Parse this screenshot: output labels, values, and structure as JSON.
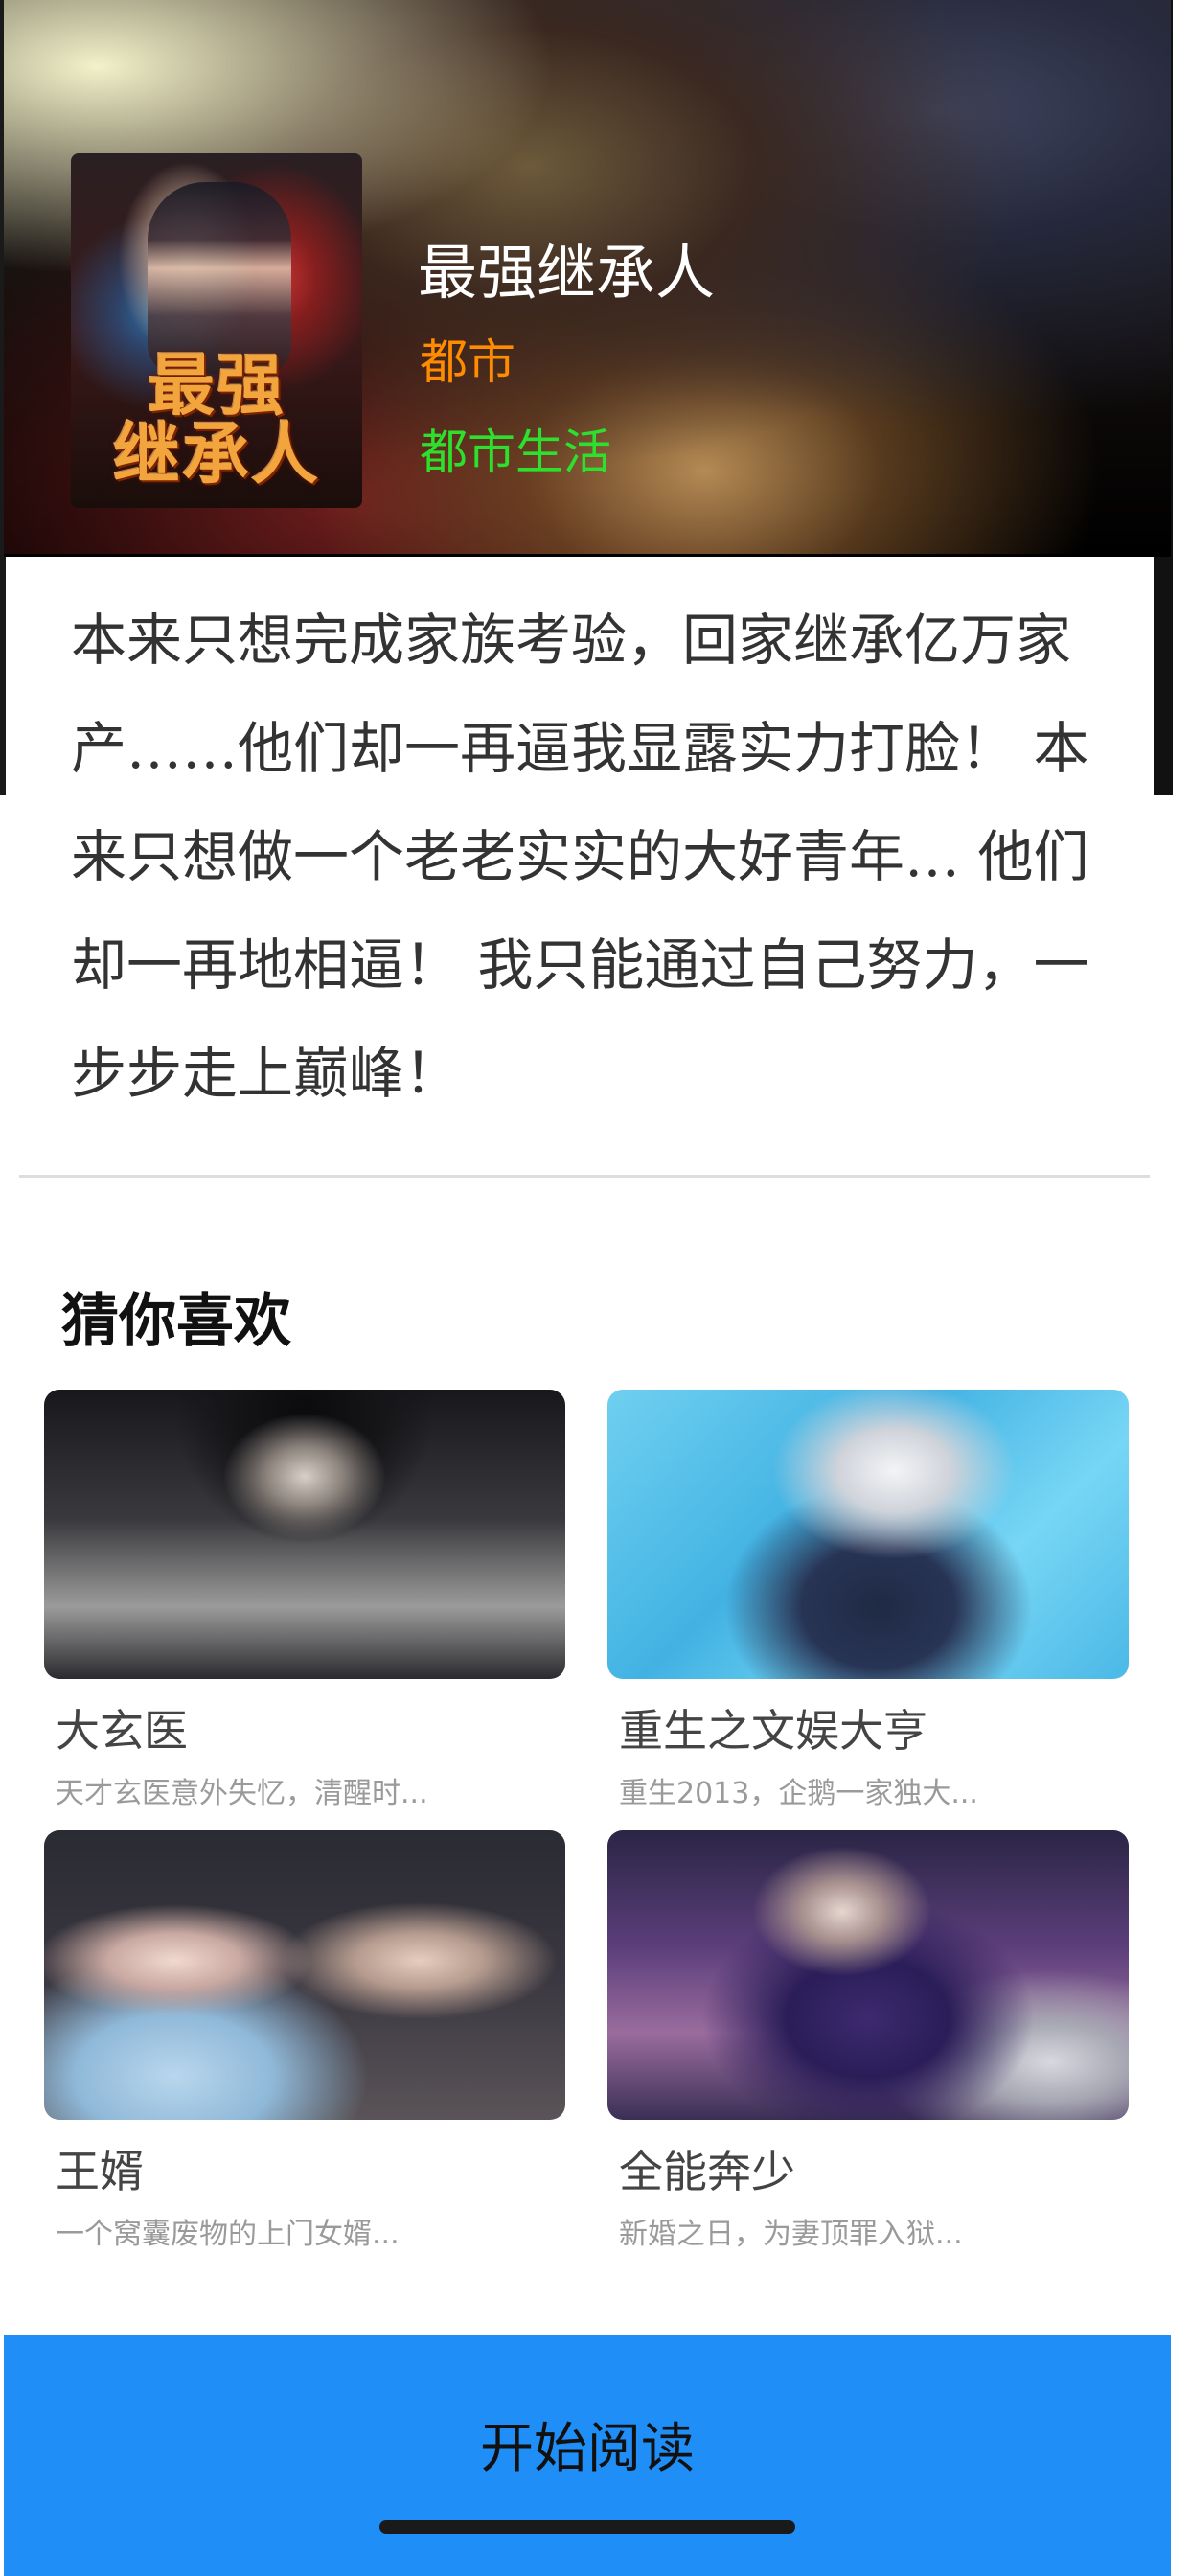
{
  "book": {
    "title": "最强继承人",
    "category": "都市",
    "subcategory": "都市生活",
    "cover_text": "最强\n继承人",
    "description": "本来只想完成家族考验，回家继承亿万家产……他们却一再逼我显露实力打脸！ 本来只想做一个老老实实的大好青年… 他们却一再地相逼！ 我只能通过自己努力，一步步走上巅峰！"
  },
  "recommendations": {
    "title": "猜你喜欢",
    "items": [
      {
        "name": "大玄医",
        "desc": "天才玄医意外失忆，清醒时..."
      },
      {
        "name": "重生之文娱大亨",
        "desc": "重生2013，企鹅一家独大..."
      },
      {
        "name": "王婿",
        "desc": "一个窝囊废物的上门女婿..."
      },
      {
        "name": "全能奔少",
        "desc": "新婚之日，为妻顶罪入狱..."
      }
    ]
  },
  "actions": {
    "start_reading": "开始阅读"
  }
}
